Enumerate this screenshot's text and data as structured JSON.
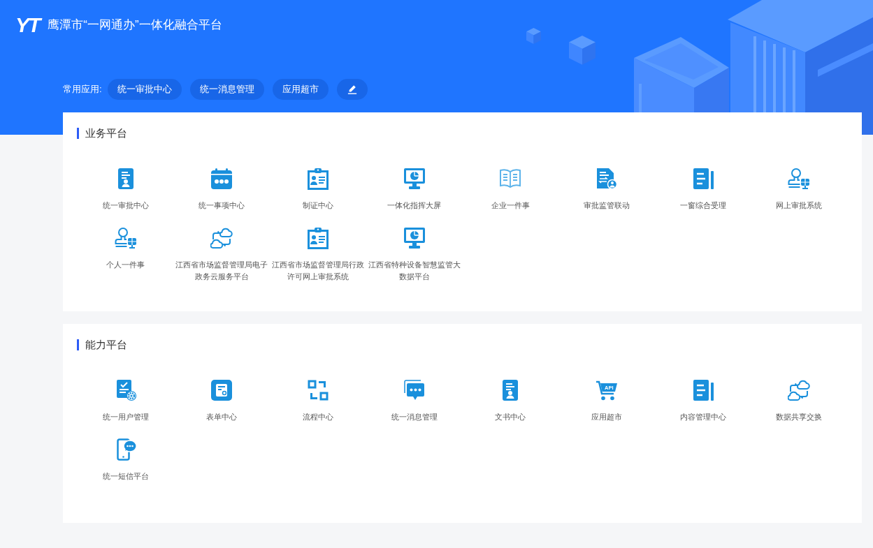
{
  "header": {
    "logo": "YT",
    "title": "鹰潭市“一网通办”一体化融合平台"
  },
  "quick_apps": {
    "label": "常用应用:",
    "items": [
      "统一审批中心",
      "统一消息管理",
      "应用超市"
    ]
  },
  "sections": [
    {
      "title": "业务平台",
      "apps": [
        {
          "label": "统一审批中心",
          "kind": "badge"
        },
        {
          "label": "统一事项中心",
          "kind": "calendar"
        },
        {
          "label": "制证中心",
          "kind": "clipboard"
        },
        {
          "label": "一体化指挥大屏",
          "kind": "monitor"
        },
        {
          "label": "企业一件事",
          "kind": "book"
        },
        {
          "label": "审批监管联动",
          "kind": "transfer"
        },
        {
          "label": "一窗综合受理",
          "kind": "ledger"
        },
        {
          "label": "网上审批系统",
          "kind": "stamp"
        },
        {
          "label": "个人一件事",
          "kind": "stamp"
        },
        {
          "label": "江西省市场监督管理局电子政务云服务平台",
          "kind": "cloud"
        },
        {
          "label": "江西省市场监督管理局行政许可网上审批系统",
          "kind": "clipboard"
        },
        {
          "label": "江西省特种设备智慧监管大数据平台",
          "kind": "monitor"
        }
      ]
    },
    {
      "title": "能力平台",
      "apps": [
        {
          "label": "统一用户管理",
          "kind": "checklist"
        },
        {
          "label": "表单中心",
          "kind": "form"
        },
        {
          "label": "流程中心",
          "kind": "flow"
        },
        {
          "label": "统一消息管理",
          "kind": "chat"
        },
        {
          "label": "文书中心",
          "kind": "badge"
        },
        {
          "label": "应用超市",
          "kind": "cart",
          "icon_text": "API"
        },
        {
          "label": "内容管理中心",
          "kind": "ledger"
        },
        {
          "label": "数据共享交换",
          "kind": "cloud"
        },
        {
          "label": "统一短信平台",
          "kind": "phone"
        }
      ]
    }
  ]
}
